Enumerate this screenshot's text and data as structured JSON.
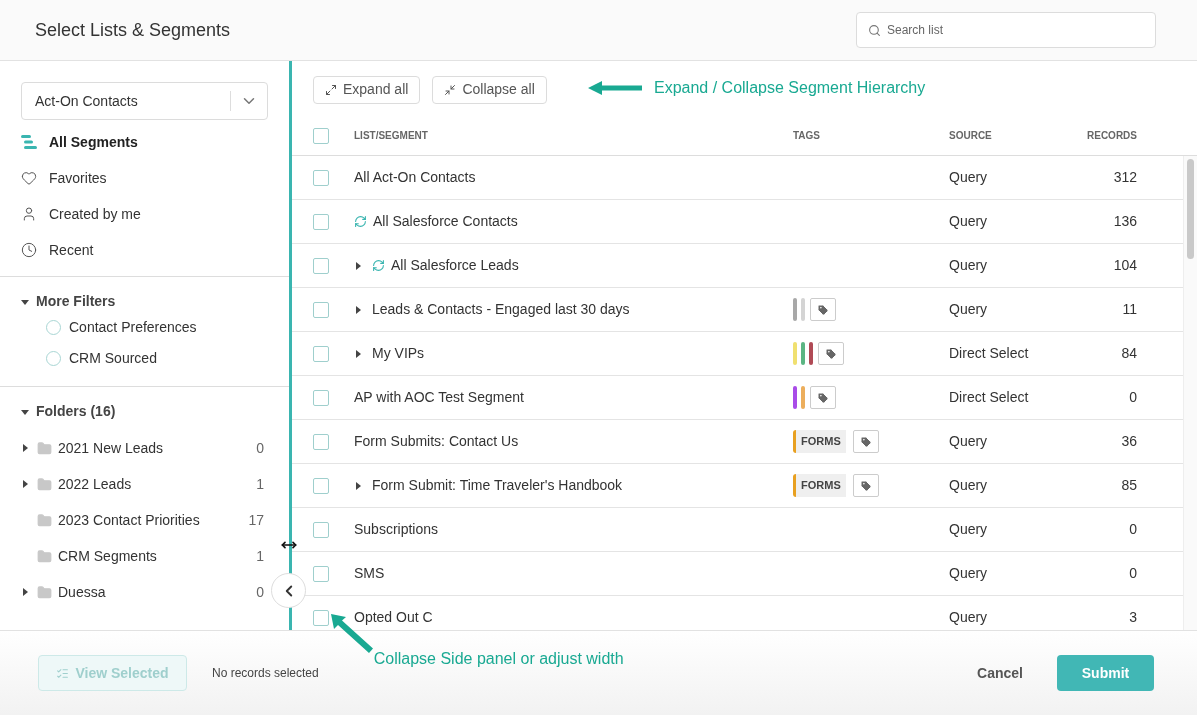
{
  "header": {
    "title": "Select Lists & Segments",
    "search": {
      "placeholder": "Search list"
    }
  },
  "sidebar": {
    "source_select": "Act-On Contacts",
    "nav": [
      {
        "kind": "segments",
        "label": "All Segments",
        "selected": true
      },
      {
        "kind": "favorites",
        "label": "Favorites",
        "selected": false
      },
      {
        "kind": "mine",
        "label": "Created by me",
        "selected": false
      },
      {
        "kind": "recent",
        "label": "Recent",
        "selected": false
      }
    ],
    "more_filters": {
      "label": "More Filters",
      "expanded": true,
      "items": [
        {
          "label": "Contact Preferences",
          "checked": false
        },
        {
          "label": "CRM Sourced",
          "checked": false
        }
      ]
    },
    "folders": {
      "label": "Folders (16)",
      "expanded": true,
      "items": [
        {
          "name": "2021 New Leads",
          "count": "0",
          "has_children": true
        },
        {
          "name": "2022 Leads",
          "count": "1",
          "has_children": true
        },
        {
          "name": "2023 Contact Priorities",
          "count": "17",
          "has_children": false
        },
        {
          "name": "CRM Segments",
          "count": "1",
          "has_children": false
        },
        {
          "name": "Duessa",
          "count": "0",
          "has_children": true
        }
      ]
    }
  },
  "toolbar": {
    "buttons": [
      {
        "kind": "expand",
        "label": "Expand all"
      },
      {
        "kind": "collapse",
        "label": "Collapse all"
      }
    ]
  },
  "table": {
    "columns": [
      "LIST/SEGMENT",
      "TAGS",
      "SOURCE",
      "RECORDS"
    ],
    "all_checked": false,
    "rows": [
      {
        "name": "All Act-On Contacts",
        "checked": false,
        "has_children": false,
        "synced": false,
        "tags": [],
        "tag_button": false,
        "source": "Query",
        "records": "312"
      },
      {
        "name": "All Salesforce Contacts",
        "checked": false,
        "has_children": false,
        "synced": true,
        "tags": [],
        "tag_button": false,
        "source": "Query",
        "records": "136"
      },
      {
        "name": "All Salesforce Leads",
        "checked": false,
        "has_children": true,
        "synced": true,
        "tags": [],
        "tag_button": false,
        "source": "Query",
        "records": "104"
      },
      {
        "name": "Leads & Contacts - Engaged last 30 days",
        "checked": false,
        "has_children": true,
        "synced": false,
        "tags": [
          {
            "kind": "bar",
            "color": "#a8a8a8"
          },
          {
            "kind": "bar",
            "color": "#d4d4d4"
          }
        ],
        "tag_button": true,
        "source": "Query",
        "records": "11"
      },
      {
        "name": "My VIPs",
        "checked": false,
        "has_children": true,
        "synced": false,
        "tags": [
          {
            "kind": "bar",
            "color": "#f0e070"
          },
          {
            "kind": "bar",
            "color": "#5bb583"
          },
          {
            "kind": "bar",
            "color": "#b04a55"
          }
        ],
        "tag_button": true,
        "source": "Direct Select",
        "records": "84"
      },
      {
        "name": "AP with AOC Test Segment",
        "checked": false,
        "has_children": false,
        "synced": false,
        "tags": [
          {
            "kind": "bar",
            "color": "#a94ce8"
          },
          {
            "kind": "bar",
            "color": "#ecae5c"
          }
        ],
        "tag_button": true,
        "source": "Direct Select",
        "records": "0"
      },
      {
        "name": "Form Submits: Contact Us",
        "checked": false,
        "has_children": false,
        "synced": false,
        "tags": [
          {
            "kind": "label",
            "text": "FORMS",
            "color": "#e8a020"
          }
        ],
        "tag_button": true,
        "source": "Query",
        "records": "36"
      },
      {
        "name": "Form Submit: Time Traveler's Handbook",
        "checked": false,
        "has_children": true,
        "synced": false,
        "tags": [
          {
            "kind": "label",
            "text": "FORMS",
            "color": "#e8a020"
          }
        ],
        "tag_button": true,
        "source": "Query",
        "records": "85"
      },
      {
        "name": "Subscriptions",
        "checked": false,
        "has_children": false,
        "synced": false,
        "tags": [],
        "tag_button": false,
        "source": "Query",
        "records": "0"
      },
      {
        "name": "SMS",
        "checked": false,
        "has_children": false,
        "synced": false,
        "tags": [],
        "tag_button": false,
        "source": "Query",
        "records": "0"
      },
      {
        "name": "Opted Out C",
        "checked": false,
        "has_children": false,
        "synced": false,
        "tags": [],
        "tag_button": false,
        "source": "Query",
        "records": "3"
      }
    ]
  },
  "annotations": [
    "Expand / Collapse Segment Hierarchy",
    "Collapse Side panel or adjust width"
  ],
  "footer": {
    "view_selected": {
      "label": "View Selected",
      "disabled": true
    },
    "status": "No records selected",
    "cancel": "Cancel",
    "submit": "Submit"
  }
}
